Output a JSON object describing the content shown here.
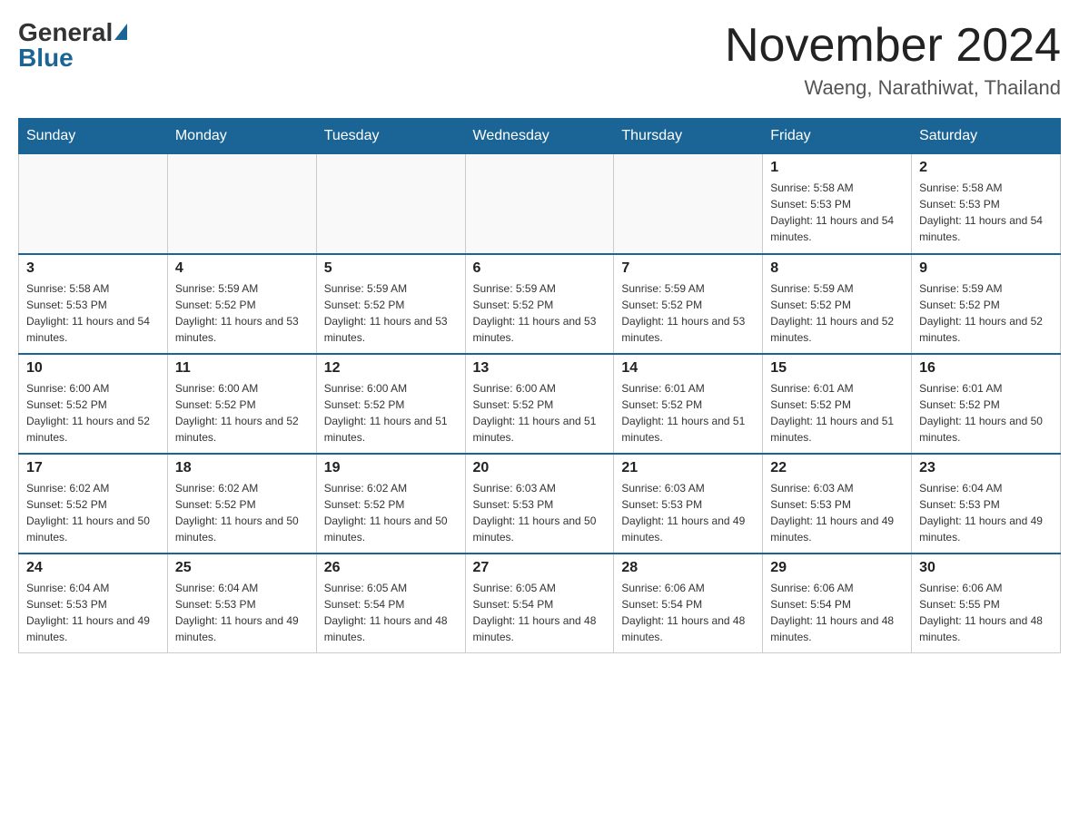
{
  "logo": {
    "general": "General",
    "blue": "Blue"
  },
  "header": {
    "month": "November 2024",
    "location": "Waeng, Narathiwat, Thailand"
  },
  "weekdays": [
    "Sunday",
    "Monday",
    "Tuesday",
    "Wednesday",
    "Thursday",
    "Friday",
    "Saturday"
  ],
  "weeks": [
    [
      {
        "day": "",
        "sunrise": "",
        "sunset": "",
        "daylight": ""
      },
      {
        "day": "",
        "sunrise": "",
        "sunset": "",
        "daylight": ""
      },
      {
        "day": "",
        "sunrise": "",
        "sunset": "",
        "daylight": ""
      },
      {
        "day": "",
        "sunrise": "",
        "sunset": "",
        "daylight": ""
      },
      {
        "day": "",
        "sunrise": "",
        "sunset": "",
        "daylight": ""
      },
      {
        "day": "1",
        "sunrise": "Sunrise: 5:58 AM",
        "sunset": "Sunset: 5:53 PM",
        "daylight": "Daylight: 11 hours and 54 minutes."
      },
      {
        "day": "2",
        "sunrise": "Sunrise: 5:58 AM",
        "sunset": "Sunset: 5:53 PM",
        "daylight": "Daylight: 11 hours and 54 minutes."
      }
    ],
    [
      {
        "day": "3",
        "sunrise": "Sunrise: 5:58 AM",
        "sunset": "Sunset: 5:53 PM",
        "daylight": "Daylight: 11 hours and 54 minutes."
      },
      {
        "day": "4",
        "sunrise": "Sunrise: 5:59 AM",
        "sunset": "Sunset: 5:52 PM",
        "daylight": "Daylight: 11 hours and 53 minutes."
      },
      {
        "day": "5",
        "sunrise": "Sunrise: 5:59 AM",
        "sunset": "Sunset: 5:52 PM",
        "daylight": "Daylight: 11 hours and 53 minutes."
      },
      {
        "day": "6",
        "sunrise": "Sunrise: 5:59 AM",
        "sunset": "Sunset: 5:52 PM",
        "daylight": "Daylight: 11 hours and 53 minutes."
      },
      {
        "day": "7",
        "sunrise": "Sunrise: 5:59 AM",
        "sunset": "Sunset: 5:52 PM",
        "daylight": "Daylight: 11 hours and 53 minutes."
      },
      {
        "day": "8",
        "sunrise": "Sunrise: 5:59 AM",
        "sunset": "Sunset: 5:52 PM",
        "daylight": "Daylight: 11 hours and 52 minutes."
      },
      {
        "day": "9",
        "sunrise": "Sunrise: 5:59 AM",
        "sunset": "Sunset: 5:52 PM",
        "daylight": "Daylight: 11 hours and 52 minutes."
      }
    ],
    [
      {
        "day": "10",
        "sunrise": "Sunrise: 6:00 AM",
        "sunset": "Sunset: 5:52 PM",
        "daylight": "Daylight: 11 hours and 52 minutes."
      },
      {
        "day": "11",
        "sunrise": "Sunrise: 6:00 AM",
        "sunset": "Sunset: 5:52 PM",
        "daylight": "Daylight: 11 hours and 52 minutes."
      },
      {
        "day": "12",
        "sunrise": "Sunrise: 6:00 AM",
        "sunset": "Sunset: 5:52 PM",
        "daylight": "Daylight: 11 hours and 51 minutes."
      },
      {
        "day": "13",
        "sunrise": "Sunrise: 6:00 AM",
        "sunset": "Sunset: 5:52 PM",
        "daylight": "Daylight: 11 hours and 51 minutes."
      },
      {
        "day": "14",
        "sunrise": "Sunrise: 6:01 AM",
        "sunset": "Sunset: 5:52 PM",
        "daylight": "Daylight: 11 hours and 51 minutes."
      },
      {
        "day": "15",
        "sunrise": "Sunrise: 6:01 AM",
        "sunset": "Sunset: 5:52 PM",
        "daylight": "Daylight: 11 hours and 51 minutes."
      },
      {
        "day": "16",
        "sunrise": "Sunrise: 6:01 AM",
        "sunset": "Sunset: 5:52 PM",
        "daylight": "Daylight: 11 hours and 50 minutes."
      }
    ],
    [
      {
        "day": "17",
        "sunrise": "Sunrise: 6:02 AM",
        "sunset": "Sunset: 5:52 PM",
        "daylight": "Daylight: 11 hours and 50 minutes."
      },
      {
        "day": "18",
        "sunrise": "Sunrise: 6:02 AM",
        "sunset": "Sunset: 5:52 PM",
        "daylight": "Daylight: 11 hours and 50 minutes."
      },
      {
        "day": "19",
        "sunrise": "Sunrise: 6:02 AM",
        "sunset": "Sunset: 5:52 PM",
        "daylight": "Daylight: 11 hours and 50 minutes."
      },
      {
        "day": "20",
        "sunrise": "Sunrise: 6:03 AM",
        "sunset": "Sunset: 5:53 PM",
        "daylight": "Daylight: 11 hours and 50 minutes."
      },
      {
        "day": "21",
        "sunrise": "Sunrise: 6:03 AM",
        "sunset": "Sunset: 5:53 PM",
        "daylight": "Daylight: 11 hours and 49 minutes."
      },
      {
        "day": "22",
        "sunrise": "Sunrise: 6:03 AM",
        "sunset": "Sunset: 5:53 PM",
        "daylight": "Daylight: 11 hours and 49 minutes."
      },
      {
        "day": "23",
        "sunrise": "Sunrise: 6:04 AM",
        "sunset": "Sunset: 5:53 PM",
        "daylight": "Daylight: 11 hours and 49 minutes."
      }
    ],
    [
      {
        "day": "24",
        "sunrise": "Sunrise: 6:04 AM",
        "sunset": "Sunset: 5:53 PM",
        "daylight": "Daylight: 11 hours and 49 minutes."
      },
      {
        "day": "25",
        "sunrise": "Sunrise: 6:04 AM",
        "sunset": "Sunset: 5:53 PM",
        "daylight": "Daylight: 11 hours and 49 minutes."
      },
      {
        "day": "26",
        "sunrise": "Sunrise: 6:05 AM",
        "sunset": "Sunset: 5:54 PM",
        "daylight": "Daylight: 11 hours and 48 minutes."
      },
      {
        "day": "27",
        "sunrise": "Sunrise: 6:05 AM",
        "sunset": "Sunset: 5:54 PM",
        "daylight": "Daylight: 11 hours and 48 minutes."
      },
      {
        "day": "28",
        "sunrise": "Sunrise: 6:06 AM",
        "sunset": "Sunset: 5:54 PM",
        "daylight": "Daylight: 11 hours and 48 minutes."
      },
      {
        "day": "29",
        "sunrise": "Sunrise: 6:06 AM",
        "sunset": "Sunset: 5:54 PM",
        "daylight": "Daylight: 11 hours and 48 minutes."
      },
      {
        "day": "30",
        "sunrise": "Sunrise: 6:06 AM",
        "sunset": "Sunset: 5:55 PM",
        "daylight": "Daylight: 11 hours and 48 minutes."
      }
    ]
  ]
}
